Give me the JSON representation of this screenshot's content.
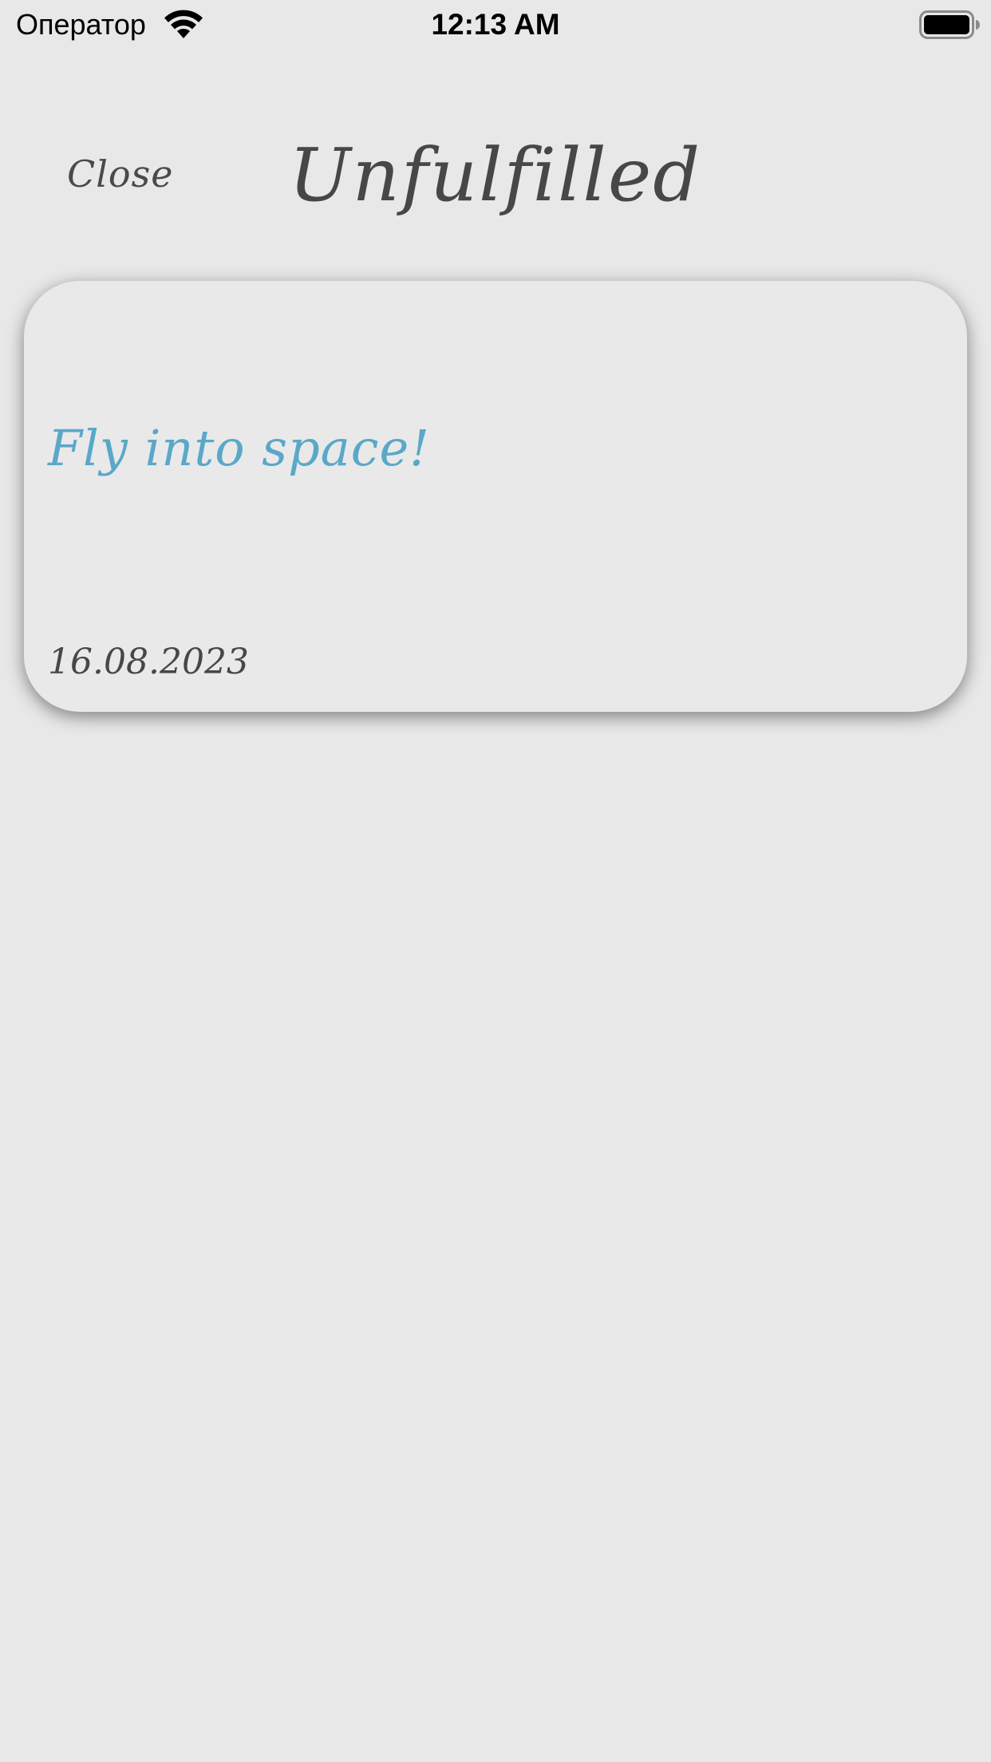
{
  "status_bar": {
    "carrier": "Оператор",
    "time": "12:13 AM",
    "wifi_icon": "wifi-icon",
    "battery_icon": "battery-icon"
  },
  "nav": {
    "close_label": "Close",
    "title": "Unfulfilled"
  },
  "items": [
    {
      "title": "Fly into space!",
      "date": "16.08.2023",
      "title_color": "#5aa8c8"
    }
  ]
}
